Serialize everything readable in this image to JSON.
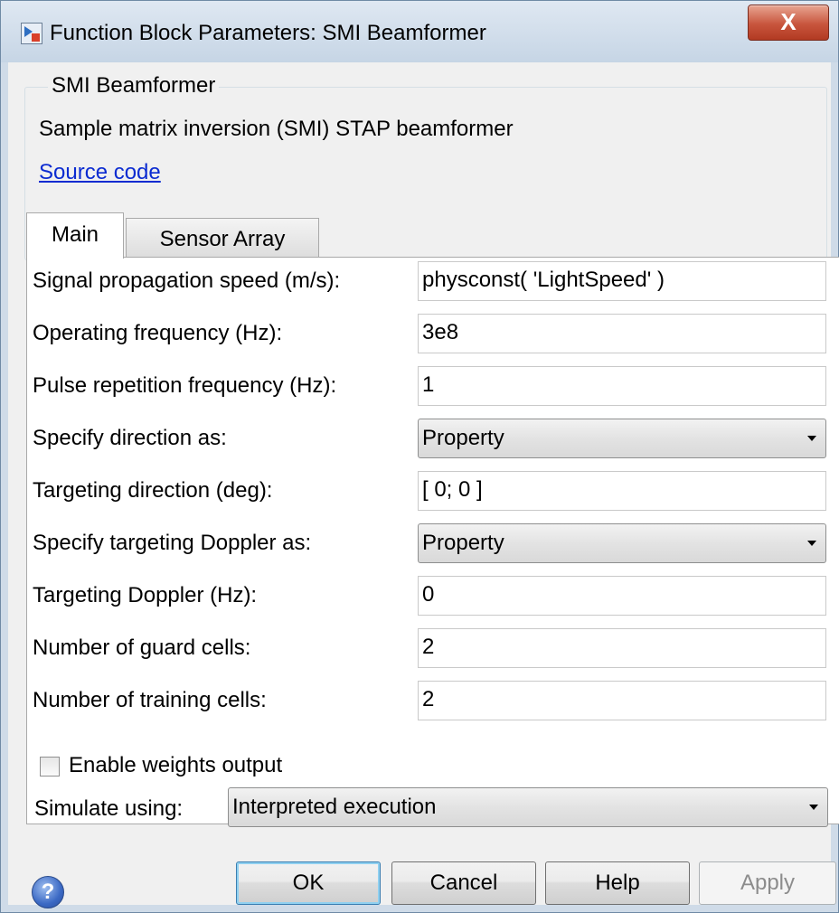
{
  "window": {
    "title": "Function Block Parameters: SMI Beamformer",
    "close_glyph": "X"
  },
  "header": {
    "group_title": "SMI Beamformer",
    "description": "Sample matrix inversion (SMI) STAP beamformer",
    "source_link": "Source code"
  },
  "tabs": [
    {
      "label": "Main",
      "active": true
    },
    {
      "label": "Sensor Array",
      "active": false
    }
  ],
  "params": [
    {
      "label": "Signal propagation speed (m/s):",
      "value": "physconst( 'LightSpeed' )",
      "kind": "edit"
    },
    {
      "label": "Operating frequency (Hz):",
      "value": "3e8",
      "kind": "edit"
    },
    {
      "label": "Pulse repetition frequency (Hz):",
      "value": "1",
      "kind": "edit"
    },
    {
      "label": "Specify direction as:",
      "value": "Property",
      "kind": "dropdown"
    },
    {
      "label": "Targeting direction (deg):",
      "value": "[ 0; 0 ]",
      "kind": "edit"
    },
    {
      "label": "Specify targeting Doppler as:",
      "value": "Property",
      "kind": "dropdown"
    },
    {
      "label": "Targeting Doppler (Hz):",
      "value": "0",
      "kind": "edit"
    },
    {
      "label": "Number of guard cells:",
      "value": "2",
      "kind": "edit"
    },
    {
      "label": "Number of training cells:",
      "value": "2",
      "kind": "edit"
    }
  ],
  "weights_output": {
    "label": "Enable weights output",
    "checked": false
  },
  "simulate": {
    "label": "Simulate using:",
    "value": "Interpreted execution"
  },
  "buttons": {
    "help_icon_glyph": "?",
    "ok": "OK",
    "cancel": "Cancel",
    "help": "Help",
    "apply": "Apply"
  },
  "colors": {
    "link": "#0b2bd1",
    "close_button": "#c8553d",
    "title_bar": "#cfdbe8"
  }
}
